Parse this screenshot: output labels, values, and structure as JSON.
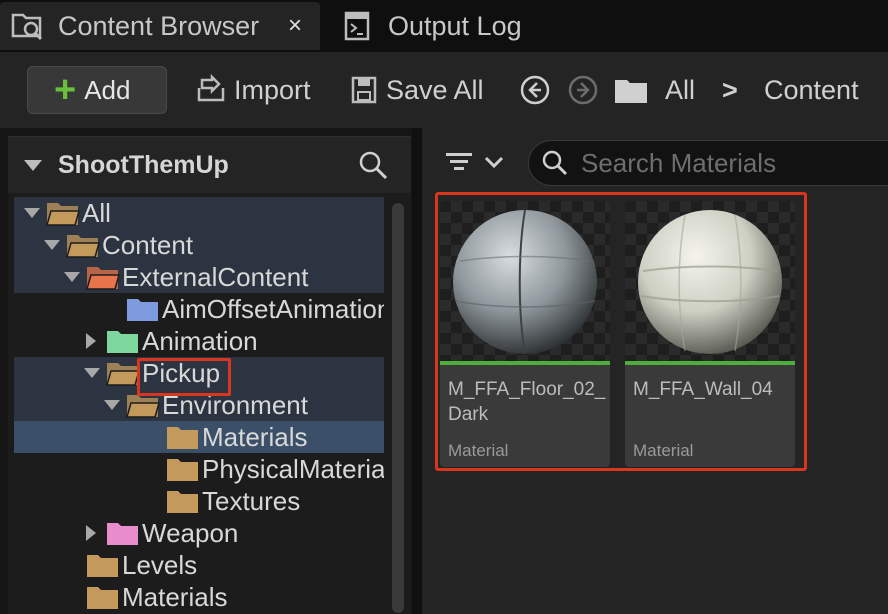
{
  "tabs": [
    {
      "label": "Content Browser",
      "icon": "content-browser-icon",
      "active": true,
      "close": "×"
    },
    {
      "label": "Output Log",
      "icon": "output-log-icon",
      "active": false
    }
  ],
  "toolbar": {
    "add_label": "Add",
    "import_label": "Import",
    "save_all_label": "Save All",
    "breadcrumb": [
      "All",
      "Content"
    ],
    "separator": ">"
  },
  "sources": {
    "title": "ShootThemUp",
    "tree": [
      {
        "label": "All",
        "depth": 0,
        "expand": "down",
        "folder_color": "#c49a5c",
        "open": true
      },
      {
        "label": "Content",
        "depth": 1,
        "expand": "down",
        "folder_color": "#c49a5c",
        "open": true
      },
      {
        "label": "ExternalContent",
        "depth": 2,
        "expand": "down",
        "folder_color": "#e8744c",
        "open": true
      },
      {
        "label": "AimOffsetAnimation",
        "depth": 4,
        "expand": "none",
        "folder_color": "#7e9be0",
        "open": false
      },
      {
        "label": "Animation",
        "depth": 3,
        "expand": "right",
        "folder_color": "#7ed89e",
        "open": false
      },
      {
        "label": "Pickup",
        "depth": 3,
        "expand": "down",
        "folder_color": "#c49a5c",
        "open": true
      },
      {
        "label": "Environment",
        "depth": 4,
        "expand": "down",
        "folder_color": "#c49a5c",
        "open": true
      },
      {
        "label": "Materials",
        "depth": 6,
        "expand": "none",
        "folder_color": "#c49a5c",
        "open": false
      },
      {
        "label": "PhysicalMateria",
        "depth": 6,
        "expand": "none",
        "folder_color": "#c49a5c",
        "open": false
      },
      {
        "label": "Textures",
        "depth": 6,
        "expand": "none",
        "folder_color": "#c49a5c",
        "open": false
      },
      {
        "label": "Weapon",
        "depth": 3,
        "expand": "right",
        "folder_color": "#e88ccc",
        "open": false
      },
      {
        "label": "Levels",
        "depth": 2,
        "expand": "none",
        "folder_color": "#c49a5c",
        "open": false
      },
      {
        "label": "Materials",
        "depth": 2,
        "expand": "none",
        "folder_color": "#c49a5c",
        "open": false
      }
    ]
  },
  "search": {
    "placeholder": "Search Materials"
  },
  "assets": [
    {
      "name": "M_FFA_Floor_02_Dark",
      "type": "Material",
      "sphere_color": "#9aa4aa"
    },
    {
      "name": "M_FFA_Wall_04",
      "type": "Material",
      "sphere_color": "#dcddd2"
    }
  ],
  "colors": {
    "accent_green": "#6ac03c",
    "highlight_red": "#d8361e",
    "selected_row": "#3b5068"
  }
}
